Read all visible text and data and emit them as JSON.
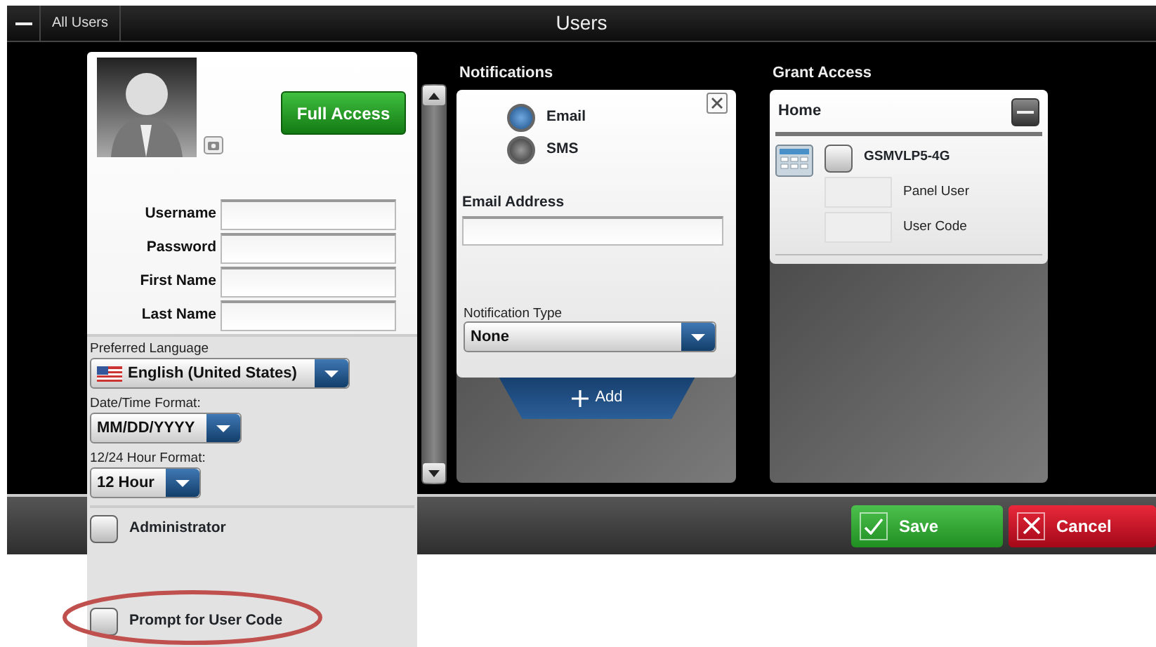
{
  "header": {
    "tab": "All Users",
    "title": "Users"
  },
  "user_form": {
    "full_access_button": "Full Access",
    "fields": [
      {
        "label": "Username"
      },
      {
        "label": "Password"
      },
      {
        "label": "First Name"
      },
      {
        "label": "Last Name"
      }
    ],
    "selects": [
      {
        "label": "Preferred Language",
        "value": "English (United States)",
        "kind": "flag"
      },
      {
        "label": "Date/Time Format:",
        "value": "MM/DD/YYYY",
        "kind": "plain"
      },
      {
        "label": "12/24 Hour Format:",
        "value": "12 Hour",
        "kind": "plain"
      }
    ],
    "checkboxes": [
      {
        "label": "Administrator",
        "checked": false,
        "highlighted": false
      },
      {
        "label": "Prompt for User Code",
        "checked": false,
        "highlighted": true
      }
    ]
  },
  "notifications": {
    "title": "Notifications",
    "options": [
      {
        "label": "Email",
        "selected": true
      },
      {
        "label": "SMS",
        "selected": false
      }
    ],
    "email_label": "Email Address",
    "type_label": "Notification Type",
    "type_value": "None",
    "add_button": "Add"
  },
  "grant_access": {
    "title": "Grant Access",
    "location": "Home",
    "devices": [
      {
        "name": "GSMVLP5-4G",
        "checked": false,
        "fields": [
          "Panel User",
          "User Code"
        ]
      }
    ]
  },
  "buttons": [
    {
      "label": "Save",
      "kind": "save"
    },
    {
      "label": "Cancel",
      "kind": "cancel"
    }
  ]
}
